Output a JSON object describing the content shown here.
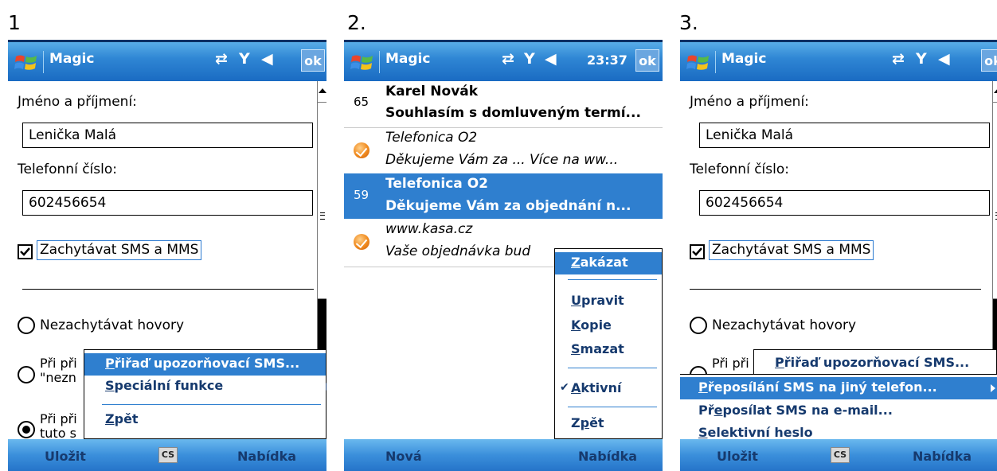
{
  "panels": [
    {
      "number": "1"
    },
    {
      "number": "2."
    },
    {
      "number": "3."
    }
  ],
  "titlebar": {
    "app_title": "Magic",
    "ok_label": "ok",
    "clock": "23:37",
    "icons": [
      "windows-start-icon",
      "connectivity-icon",
      "signal-icon",
      "volume-icon"
    ]
  },
  "form": {
    "name_label": "Jméno a příjmení:",
    "name_value": "Lenička Malá",
    "phone_label": "Telefonní číslo:",
    "phone_value": "602456654",
    "capture_label": "Zachytávat SMS a MMS",
    "radio1": "Nezachytávat hovory",
    "radio2_line1": "Při při",
    "radio2_line2": "\"nezn",
    "radio3_line1": "Při při",
    "radio3_line2": "tuto s"
  },
  "bottombar": {
    "left1": "Uložit",
    "sip": "CS",
    "right": "Nabídka",
    "left2": "Nová"
  },
  "menu1": {
    "items": [
      {
        "pre": "",
        "u": "P",
        "post": "řiřaď upozorňovací SMS..."
      },
      {
        "pre": "",
        "u": "S",
        "post": "peciální funkce"
      },
      {
        "pre": "",
        "u": "Z",
        "post": "pět"
      }
    ]
  },
  "inbox": {
    "messages": [
      {
        "count": "65",
        "from": "Karel Novák",
        "text": "Souhlasím s domluveným termí..."
      },
      {
        "from": "Telefonica O2",
        "text": "Děkujeme Vám za ... Více na ww..."
      },
      {
        "count": "59",
        "from": "Telefonica O2",
        "text": "Děkujeme Vám za objednání n..."
      },
      {
        "from": "www.kasa.cz",
        "text": "Vaše objednávka bud"
      }
    ]
  },
  "menu2": {
    "items": [
      {
        "u": "Z",
        "post": "akázat"
      },
      {
        "u": "U",
        "post": "pravit"
      },
      {
        "u": "K",
        "post": "opie"
      },
      {
        "u": "S",
        "post": "mazat"
      },
      {
        "u": "A",
        "post": "ktivní"
      },
      {
        "pre": "Z",
        "u": "p",
        "post": "ět"
      }
    ],
    "check": "✔"
  },
  "menu3": {
    "parent": {
      "u": "P",
      "post": "řiřaď upozorňovací SMS..."
    },
    "items": [
      {
        "u": "P",
        "post": "řeposílání SMS na jiný telefon..."
      },
      {
        "pre": "Př",
        "u": "e",
        "post": "posílat SMS na e-mail..."
      },
      {
        "u": "S",
        "post": "elektivní heslo"
      }
    ]
  },
  "colors": {
    "highlight": "#2f7fcf",
    "titlebar": "#2f86d4",
    "menu_text": "#163a6e"
  }
}
